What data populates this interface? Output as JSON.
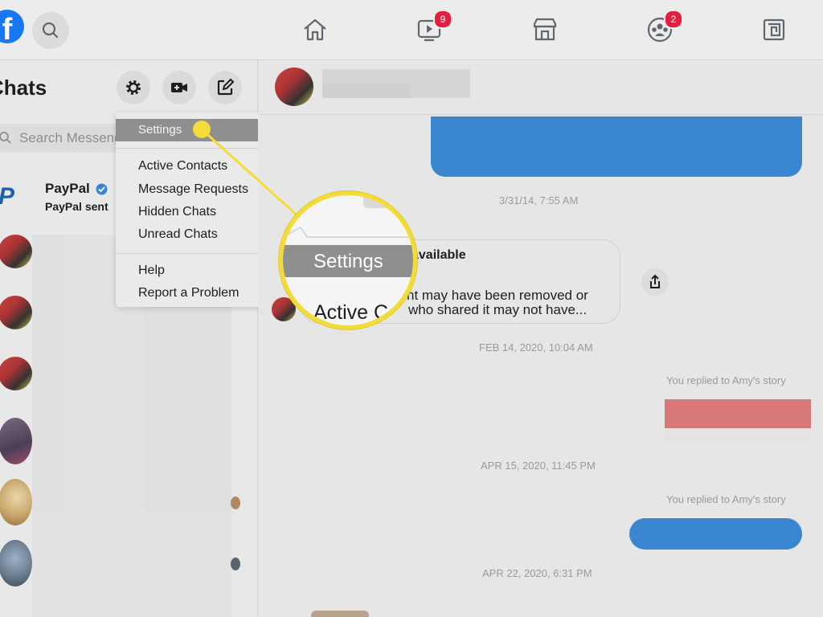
{
  "colors": {
    "accent": "#1877f2",
    "badge": "#e41e3f",
    "highlight": "#f3dc3a",
    "bubble": "#3a86d0",
    "story_reply": "#d9787a"
  },
  "topbar": {
    "logo": "f",
    "search_icon": "search-icon",
    "nav": [
      {
        "icon": "home-icon",
        "badge": ""
      },
      {
        "icon": "watch-icon",
        "badge": "9"
      },
      {
        "icon": "marketplace-icon",
        "badge": ""
      },
      {
        "icon": "groups-icon",
        "badge": "2"
      },
      {
        "icon": "gaming-icon",
        "badge": ""
      }
    ]
  },
  "sidebar": {
    "title": "Chats",
    "search_placeholder": "Search Messenger",
    "buttons": [
      "gear-icon",
      "video-call-icon",
      "compose-icon"
    ],
    "chats": [
      {
        "name": "PayPal",
        "verified": true,
        "preview": "PayPal sent"
      }
    ]
  },
  "settings_menu": {
    "items": [
      "Settings",
      "Active Contacts",
      "Message Requests",
      "Hidden Chats",
      "Unread Chats",
      "Help",
      "Report a Problem"
    ],
    "selected": "Settings"
  },
  "conversation": {
    "timestamps": [
      "3/31/14, 7:55 AM",
      "FEB 14, 2020, 10:04 AM",
      "APR 15, 2020, 11:45 PM",
      "APR 22, 2020, 6:31 PM"
    ],
    "unavailable_title": "available",
    "unavailable_line1": "nt may have been removed or",
    "unavailable_line2": "who shared it may not have...",
    "story_reply_label": "You replied to Amy's story"
  },
  "callout": {
    "settings": "Settings",
    "active": "Active C"
  }
}
